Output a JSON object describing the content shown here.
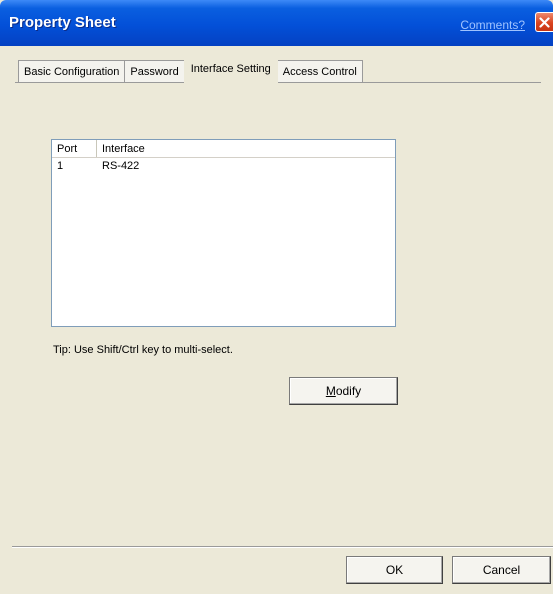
{
  "window": {
    "title": "Property Sheet",
    "comments_link": "Comments?",
    "close_icon": "close-icon"
  },
  "tabs": [
    {
      "label": "Basic Configuration",
      "active": false
    },
    {
      "label": "Password",
      "active": false
    },
    {
      "label": "Interface Setting",
      "active": true
    },
    {
      "label": "Access Control",
      "active": false
    }
  ],
  "listview": {
    "columns": [
      "Port",
      "Interface"
    ],
    "rows": [
      {
        "port": "1",
        "interface": "RS-422"
      }
    ]
  },
  "tip": "Tip: Use Shift/Ctrl key to multi-select.",
  "buttons": {
    "modify_mnemonic": "M",
    "modify_rest": "odify",
    "ok": "OK",
    "cancel": "Cancel"
  },
  "colors": {
    "titlebar": "#0350d8",
    "dialog_bg": "#ece9d8",
    "close_red": "#d9431f"
  }
}
